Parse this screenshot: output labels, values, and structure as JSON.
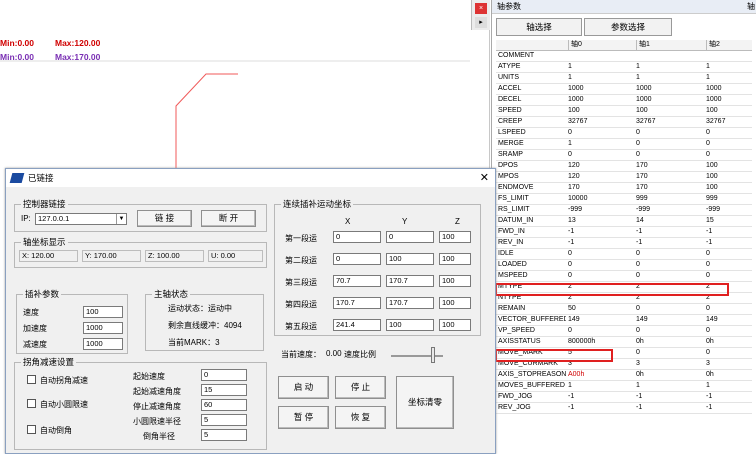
{
  "plot": {
    "legend": [
      {
        "min": "Min:0.00",
        "max": "Max:120.00"
      },
      {
        "min": "Min:0.00",
        "max": "Max:170.00"
      }
    ],
    "close_glyph": "×",
    "arrow_glyph": "▸"
  },
  "axis": {
    "title": "轴参数",
    "title_extra": "轴",
    "tabs": [
      "轴选择",
      "参数选择"
    ],
    "columns": [
      "",
      "轴0",
      "轴1",
      "轴2"
    ],
    "rows": [
      [
        "COMMENT",
        "",
        "",
        ""
      ],
      [
        "ATYPE",
        "1",
        "1",
        "1"
      ],
      [
        "UNITS",
        "1",
        "1",
        "1"
      ],
      [
        "ACCEL",
        "1000",
        "1000",
        "1000"
      ],
      [
        "DECEL",
        "1000",
        "1000",
        "1000"
      ],
      [
        "SPEED",
        "100",
        "100",
        "100"
      ],
      [
        "CREEP",
        "32767",
        "32767",
        "32767"
      ],
      [
        "LSPEED",
        "0",
        "0",
        "0"
      ],
      [
        "MERGE",
        "1",
        "0",
        "0"
      ],
      [
        "SRAMP",
        "0",
        "0",
        "0"
      ],
      [
        "DPOS",
        "120",
        "170",
        "100"
      ],
      [
        "MPOS",
        "120",
        "170",
        "100"
      ],
      [
        "ENDMOVE",
        "170",
        "170",
        "100"
      ],
      [
        "FS_LIMIT",
        "10000",
        "999",
        "999"
      ],
      [
        "RS_LIMIT",
        "-999",
        "-999",
        "-999"
      ],
      [
        "DATUM_IN",
        "13",
        "14",
        "15"
      ],
      [
        "FWD_IN",
        "-1",
        "-1",
        "-1"
      ],
      [
        "REV_IN",
        "-1",
        "-1",
        "-1"
      ],
      [
        "IDLE",
        "0",
        "0",
        "0"
      ],
      [
        "LOADED",
        "0",
        "0",
        "0"
      ],
      [
        "MSPEED",
        "0",
        "0",
        "0"
      ],
      [
        "MTYPE",
        "2",
        "2",
        "2"
      ],
      [
        "NTYPE",
        "2",
        "2",
        "2"
      ],
      [
        "REMAIN",
        "50",
        "0",
        "0"
      ],
      [
        "VECTOR_BUFFERED",
        "149",
        "149",
        "149"
      ],
      [
        "VP_SPEED",
        "0",
        "0",
        "0"
      ],
      [
        "AXISSTATUS",
        "800000h",
        "0h",
        "0h"
      ],
      [
        "MOVE_MARK",
        "5",
        "0",
        "0"
      ],
      [
        "MOVE_CURMARK",
        "3",
        "3",
        "3"
      ],
      [
        "AXIS_STOPREASON",
        "A00h",
        "0h",
        "0h"
      ],
      [
        "MOVES_BUFFERED",
        "1",
        "1",
        "1"
      ],
      [
        "FWD_JOG",
        "-1",
        "-1",
        "-1"
      ],
      [
        "REV_JOG",
        "-1",
        "-1",
        "-1"
      ]
    ]
  },
  "dialog": {
    "title": "已链接",
    "close": "✕",
    "ctrl": {
      "label": "控制器链接",
      "ip_label": "IP:",
      "ip_value": "127.0.0.1",
      "connect": "链 接",
      "disconnect": "断 开"
    },
    "coord": {
      "label": "轴坐标显示",
      "x": "X: 120.00",
      "y": "Y: 170.00",
      "z": "Z: 100.00",
      "u": "U: 0.00"
    },
    "interp": {
      "label": "插补参数",
      "speed_label": "速度",
      "speed": "100",
      "accel_label": "加速度",
      "accel": "1000",
      "decel_label": "减速度",
      "decel": "1000"
    },
    "status": {
      "label": "主轴状态",
      "run": "运动状态：运动中",
      "remain": "剩余直线缓冲：4094",
      "mark": "当前MARK：3"
    },
    "corner": {
      "label": "拐角减速设置",
      "chk1": "自动拐角减速",
      "chk2": "自动小圆限速",
      "chk3": "自动倒角",
      "start_speed_label": "起始速度",
      "start_speed": "0",
      "start_angle_label": "起始减速角度",
      "start_angle": "15",
      "stop_angle_label": "停止减速角度",
      "stop_angle": "60",
      "radius_label": "小圆限速半径",
      "radius": "5",
      "chamfer_label": "倒角半径",
      "chamfer": "5"
    },
    "cont": {
      "label": "连续插补运动坐标",
      "cols": [
        "X",
        "Y",
        "Z"
      ],
      "segments": [
        {
          "name": "第一段运",
          "x": "0",
          "y": "0",
          "z": "100"
        },
        {
          "name": "第二段运",
          "x": "0",
          "y": "100",
          "z": "100"
        },
        {
          "name": "第三段运",
          "x": "70.7",
          "y": "170.7",
          "z": "100"
        },
        {
          "name": "第四段运",
          "x": "170.7",
          "y": "170.7",
          "z": "100"
        },
        {
          "name": "第五段运",
          "x": "241.4",
          "y": "100",
          "z": "100"
        }
      ]
    },
    "speed_ratio": {
      "label": "当前速度：",
      "value": "0.00",
      "suffix": "速度比例"
    },
    "buttons": {
      "start": "启 动",
      "stop": "停 止",
      "pause": "暂 停",
      "resume": "恢 复",
      "zero": "坐标清零"
    }
  }
}
